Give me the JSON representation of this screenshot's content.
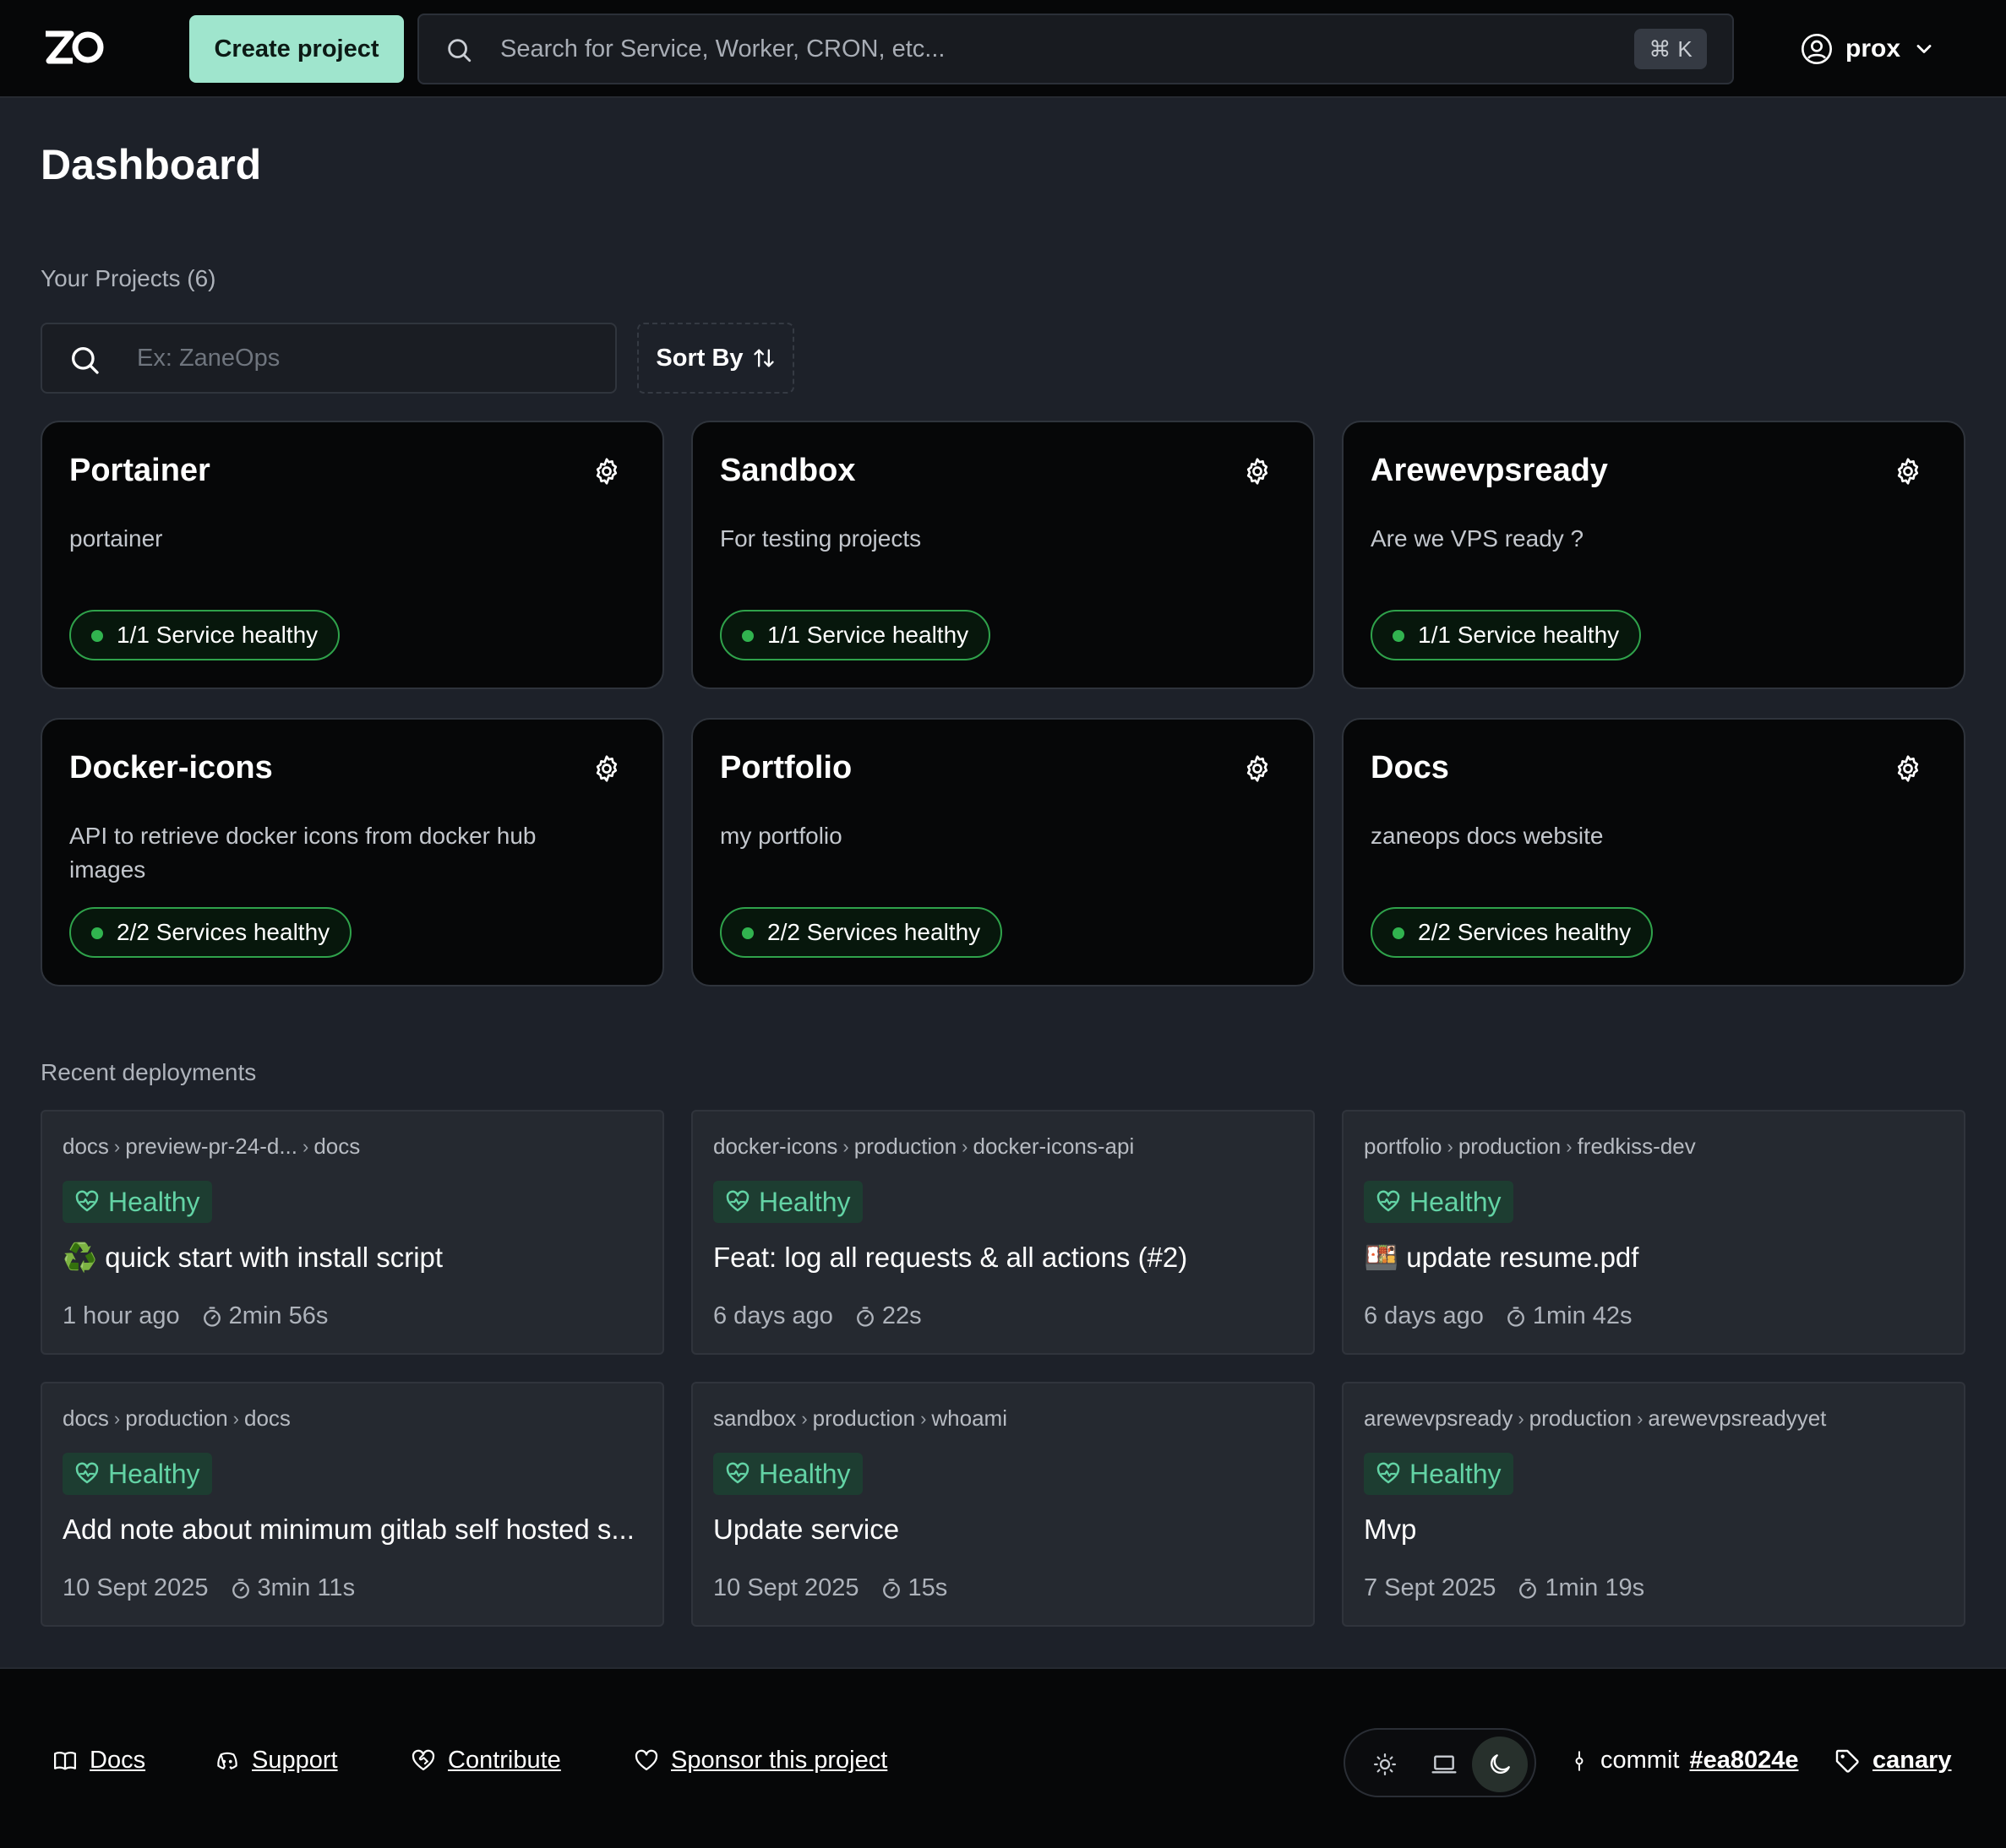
{
  "header": {
    "logo_text": "ZO",
    "create_project_label": "Create project",
    "search_placeholder": "Search for Service, Worker, CRON, etc...",
    "search_shortcut_symbol": "⌘",
    "search_shortcut_key": "K",
    "user_name": "prox"
  },
  "page": {
    "title": "Dashboard",
    "projects_label": "Your Projects (6)",
    "project_search_placeholder": "Ex: ZaneOps",
    "sort_label": "Sort By",
    "recent_label": "Recent deployments"
  },
  "projects": [
    {
      "name": "Portainer",
      "description": "portainer",
      "status": "1/1 Service healthy"
    },
    {
      "name": "Sandbox",
      "description": "For testing projects",
      "status": "1/1 Service healthy"
    },
    {
      "name": "Arewevpsready",
      "description": "Are we VPS ready ?",
      "status": "1/1 Service healthy"
    },
    {
      "name": "Docker-icons",
      "description": "API to retrieve docker icons from docker hub images",
      "status": "2/2 Services healthy"
    },
    {
      "name": "Portfolio",
      "description": "my portfolio",
      "status": "2/2 Services healthy"
    },
    {
      "name": "Docs",
      "description": "zaneops docs website",
      "status": "2/2 Services healthy"
    }
  ],
  "deployments": [
    {
      "project": "docs",
      "environment": "preview-pr-24-d...",
      "service": "docs",
      "status": "Healthy",
      "message": "♻️ quick start with install script",
      "time": "1 hour ago",
      "duration": "2min 56s"
    },
    {
      "project": "docker-icons",
      "environment": "production",
      "service": "docker-icons-api",
      "status": "Healthy",
      "message": "Feat: log all requests & all actions (#2)",
      "time": "6 days ago",
      "duration": "22s"
    },
    {
      "project": "portfolio",
      "environment": "production",
      "service": "fredkiss-dev",
      "status": "Healthy",
      "message": "🍱 update resume.pdf",
      "time": "6 days ago",
      "duration": "1min 42s"
    },
    {
      "project": "docs",
      "environment": "production",
      "service": "docs",
      "status": "Healthy",
      "message": "Add note about minimum gitlab self hosted s...",
      "time": "10 Sept 2025",
      "duration": "3min 11s"
    },
    {
      "project": "sandbox",
      "environment": "production",
      "service": "whoami",
      "status": "Healthy",
      "message": "Update service",
      "time": "10 Sept 2025",
      "duration": "15s"
    },
    {
      "project": "arewevpsready",
      "environment": "production",
      "service": "arewevpsreadyyet",
      "status": "Healthy",
      "message": "Mvp",
      "time": "7 Sept 2025",
      "duration": "1min 19s"
    }
  ],
  "footer": {
    "docs_label": "Docs",
    "support_label": "Support",
    "contribute_label": "Contribute",
    "sponsor_label": "Sponsor this project",
    "commit_label": "commit",
    "commit_hash": "#ea8024e",
    "channel_label": "canary",
    "theme_options": [
      "light-icon",
      "system-icon",
      "dark-icon"
    ],
    "active_theme": "dark"
  },
  "colors": {
    "accent": "#9fe5cd",
    "healthy_green": "#31b34f",
    "healthy_badge_text": "#63d3a5",
    "page_bg": "#1d2129",
    "card_bg": "#060708"
  }
}
